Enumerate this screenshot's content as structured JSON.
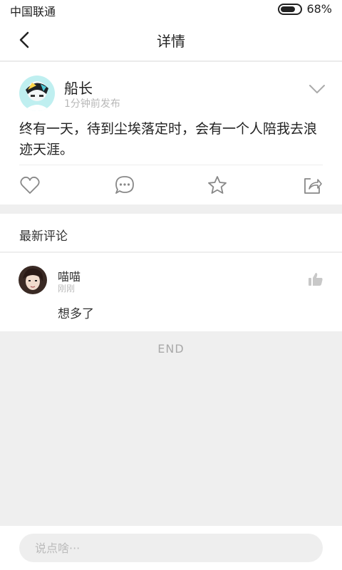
{
  "status": {
    "carrier": "中国联通",
    "battery": "68%"
  },
  "nav": {
    "title": "详情"
  },
  "post": {
    "author": "船长",
    "time": "1分钟前发布",
    "content": "终有一天，待到尘埃落定时，会有一个人陪我去浪迹天涯。"
  },
  "comments_section": {
    "title": "最新评论"
  },
  "comments": [
    {
      "name": "喵喵",
      "time": "刚刚",
      "text": "想多了"
    }
  ],
  "footer": {
    "end": "END"
  },
  "input": {
    "placeholder": "说点啥···"
  }
}
